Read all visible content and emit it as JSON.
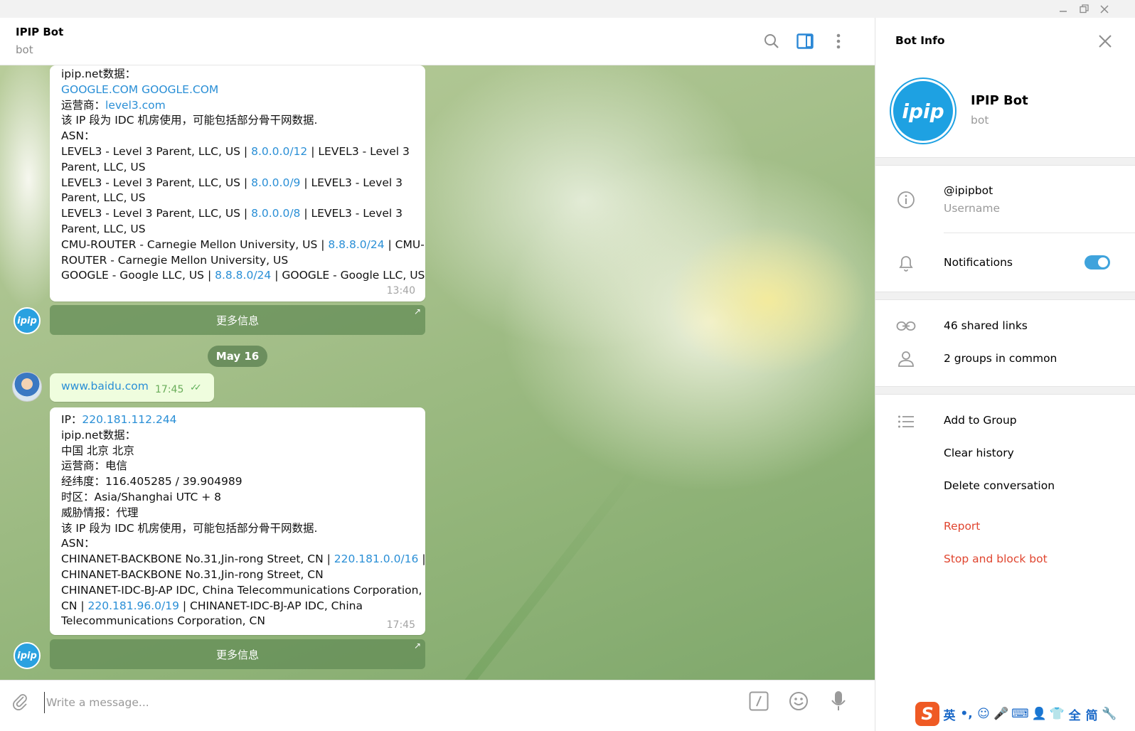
{
  "window": {
    "min_glyph": "—",
    "restore_glyph": "❐",
    "close_glyph": "✕"
  },
  "chat": {
    "title": "IPIP Bot",
    "subtitle": "bot",
    "messages": [
      {
        "lines": [
          [
            {
              "t": "ipip.net数据："
            }
          ],
          [
            {
              "t": "GOOGLE.COM GOOGLE.COM",
              "link": true
            }
          ],
          [
            {
              "t": "运营商："
            },
            {
              "t": "level3.com",
              "link": true
            }
          ],
          [
            {
              "t": "该 IP 段为 IDC 机房使用，可能包括部分骨干网数据."
            }
          ],
          [
            {
              "t": "ASN："
            }
          ],
          [
            {
              "t": "LEVEL3 - Level 3 Parent, LLC, US | "
            },
            {
              "t": "8.0.0.0/12",
              "link": true
            },
            {
              "t": " | LEVEL3 - Level 3"
            }
          ],
          [
            {
              "t": "Parent, LLC, US"
            }
          ],
          [
            {
              "t": "LEVEL3 - Level 3 Parent, LLC, US | "
            },
            {
              "t": "8.0.0.0/9",
              "link": true
            },
            {
              "t": " | LEVEL3 - Level 3"
            }
          ],
          [
            {
              "t": "Parent, LLC, US"
            }
          ],
          [
            {
              "t": "LEVEL3 - Level 3 Parent, LLC, US | "
            },
            {
              "t": "8.0.0.0/8",
              "link": true
            },
            {
              "t": " | LEVEL3 - Level 3"
            }
          ],
          [
            {
              "t": "Parent, LLC, US"
            }
          ],
          [
            {
              "t": "CMU-ROUTER - Carnegie Mellon University, US | "
            },
            {
              "t": "8.8.8.0/24",
              "link": true
            },
            {
              "t": " | CMU-"
            }
          ],
          [
            {
              "t": "ROUTER - Carnegie Mellon University, US"
            }
          ],
          [
            {
              "t": "GOOGLE - Google LLC, US | "
            },
            {
              "t": "8.8.8.0/24",
              "link": true
            },
            {
              "t": " | GOOGLE - Google LLC, US"
            }
          ]
        ],
        "time": "13:40"
      },
      {
        "lines": [
          [
            {
              "t": "IP："
            },
            {
              "t": "220.181.112.244",
              "link": true
            }
          ],
          [
            {
              "t": "ipip.net数据："
            }
          ],
          [
            {
              "t": "中国 北京 北京"
            }
          ],
          [
            {
              "t": "运营商：电信"
            }
          ],
          [
            {
              "t": "经纬度：116.405285 / 39.904989"
            }
          ],
          [
            {
              "t": "时区：Asia/Shanghai UTC + 8"
            }
          ],
          [
            {
              "t": "威胁情报：代理"
            }
          ],
          [
            {
              "t": "该 IP 段为 IDC 机房使用，可能包括部分骨干网数据."
            }
          ],
          [
            {
              "t": "ASN："
            }
          ],
          [
            {
              "t": "CHINANET-BACKBONE No.31,Jin-rong Street, CN | "
            },
            {
              "t": "220.181.0.0/16",
              "link": true
            },
            {
              "t": " |"
            }
          ],
          [
            {
              "t": "CHINANET-BACKBONE No.31,Jin-rong Street, CN"
            }
          ],
          [
            {
              "t": "CHINANET-IDC-BJ-AP IDC, China Telecommunications Corporation,"
            }
          ],
          [
            {
              "t": "CN | "
            },
            {
              "t": "220.181.96.0/19",
              "link": true
            },
            {
              "t": " | CHINANET-IDC-BJ-AP IDC, China"
            }
          ],
          [
            {
              "t": "Telecommunications Corporation, CN"
            }
          ]
        ],
        "time": "17:45"
      }
    ],
    "more_button_label": "更多信息",
    "more_button_arrow": "↗",
    "date_separator": "May 16",
    "outgoing": {
      "text": "www.baidu.com",
      "time": "17:45",
      "check_glyph": "✓✓"
    },
    "bot_avatar_text": "ipip",
    "composer_placeholder": "Write a message...",
    "bot_command_glyph": "/"
  },
  "panel": {
    "title": "Bot Info",
    "name": "IPIP Bot",
    "subtitle": "bot",
    "avatar_text": "ipip",
    "username": "@ipipbot",
    "username_label": "Username",
    "notifications_label": "Notifications",
    "notifications_on": true,
    "shared_links": "46 shared links",
    "groups_in_common": "2 groups in common",
    "add_to_group": "Add to Group",
    "clear_history": "Clear history",
    "delete_conversation": "Delete conversation",
    "report": "Report",
    "stop_block": "Stop and block bot"
  },
  "ime": {
    "logo": "S",
    "items": [
      "英",
      "•,",
      "☺",
      "🎤",
      "⌨",
      "👤",
      "👕",
      "全",
      "简",
      "🔧"
    ]
  },
  "colors": {
    "link": "#2a8fd6",
    "accent": "#3fa3dc",
    "danger": "#e0452f",
    "outgoing_bubble": "#effdde"
  }
}
